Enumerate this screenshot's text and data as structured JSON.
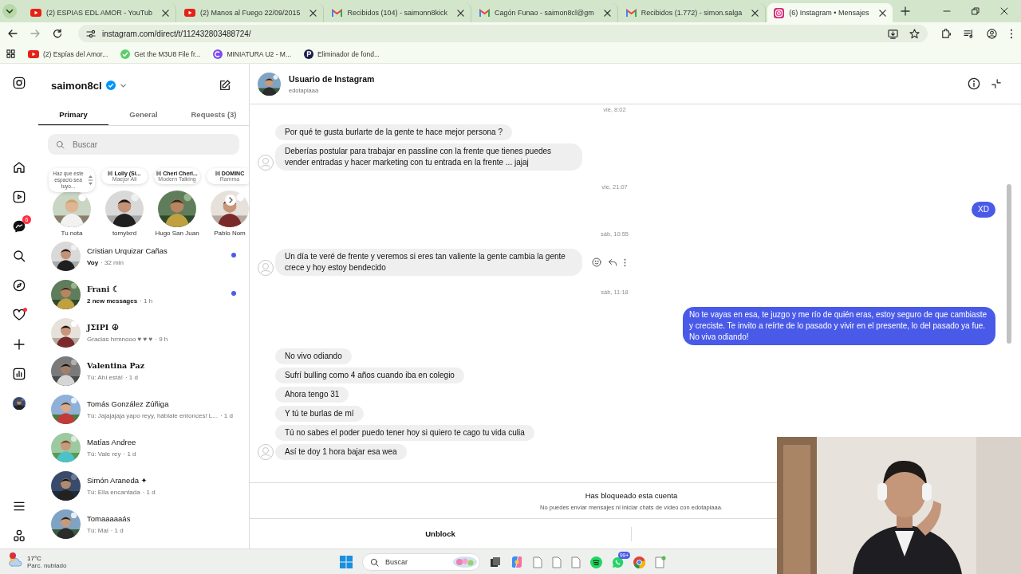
{
  "browser": {
    "tabs": [
      {
        "title": "(2) ESPIAS EDL AMOR - YouTub",
        "kind": "youtube",
        "selected": false
      },
      {
        "title": "(2) Manos al Fuego 22/09/2015",
        "kind": "youtube",
        "selected": false
      },
      {
        "title": "Recibidos (104) - saimonn8kick",
        "kind": "gmail",
        "selected": false
      },
      {
        "title": "Cagón Funao - saimon8cl@gm",
        "kind": "gmail",
        "selected": false
      },
      {
        "title": "Recibidos (1.772) - simon.salga",
        "kind": "gmail",
        "selected": false
      },
      {
        "title": "(6) Instagram • Mensajes",
        "kind": "instagram",
        "selected": true
      }
    ],
    "url": "instagram.com/direct/t/112432803488724/",
    "bookmarks": [
      {
        "label": "(2) Espías del Amor...",
        "kind": "youtube"
      },
      {
        "label": "Get the M3U8 File fr...",
        "kind": "check"
      },
      {
        "label": "MINIATURA U2 - M...",
        "kind": "canva"
      },
      {
        "label": "Eliminador de fond...",
        "kind": "remover"
      }
    ]
  },
  "nav": {
    "messages_badge": "6",
    "activity_dot": true
  },
  "inbox": {
    "username": "saimon8cl",
    "verified": true,
    "tabs": [
      {
        "label": "Primary",
        "selected": true
      },
      {
        "label": "General",
        "selected": false
      },
      {
        "label": "Requests (3)",
        "selected": false
      }
    ],
    "search": {
      "placeholder": "Buscar"
    },
    "notes": [
      {
        "kind": "text",
        "lines": [
          "Haz que este espacio sea tuyo..."
        ],
        "name": "Tu nota"
      },
      {
        "kind": "music",
        "lines": [
          "Lolly (Si...",
          "Maejor Ali"
        ],
        "name": "tomylxrd"
      },
      {
        "kind": "music",
        "lines": [
          "Cheri Cheri...",
          "Modern Talking"
        ],
        "name": "Hugo San Juan"
      },
      {
        "kind": "music",
        "lines": [
          "DOMINC",
          "Ramma"
        ],
        "name": "Pablo Nom"
      }
    ],
    "conversations": [
      {
        "name": "Cristian Urquizar Cañas",
        "fancy": false,
        "preview": "Voy",
        "time": "· 32 min",
        "unread": true
      },
      {
        "name": "Frani ☾",
        "fancy": true,
        "preview": "2 new messages",
        "time": "· 1 h",
        "unread": true
      },
      {
        "name": "JΣIPI ☮",
        "fancy": true,
        "preview": "Gracias hrmnooo ♥ ♥ ♥",
        "time": "· 9 h",
        "unread": false
      },
      {
        "name": "Valentina Paz",
        "fancy": true,
        "preview": "Tú: Ahí está!",
        "time": "· 1 d",
        "unread": false
      },
      {
        "name": "Tomás González Zúñiga",
        "fancy": false,
        "preview": "Tú: Jajajajaja yapo reyy, háblale entonces! L...",
        "time": "· 1 d",
        "unread": false
      },
      {
        "name": "Matías Andree",
        "fancy": false,
        "preview": "Tú: Vale rey",
        "time": "· 1 d",
        "unread": false
      },
      {
        "name": "Simón Araneda ✦",
        "fancy": false,
        "preview": "Tú: Ella encantada",
        "time": "· 1 d",
        "unread": false
      },
      {
        "name": "Tomaaaaaás",
        "fancy": false,
        "preview": "Tú: Mal",
        "time": "· 1 d",
        "unread": false
      }
    ]
  },
  "chat": {
    "title": "Usuario de Instagram",
    "subtitle": "edotapiaaa",
    "messages": [
      {
        "kind": "time",
        "text": "vie, 8:02"
      },
      {
        "kind": "in",
        "text": "Por qué te gusta burlarte de la gente te hace mejor persona ?",
        "avatar": false,
        "show_actions": false
      },
      {
        "kind": "in",
        "text": "Deberías postular para trabajar en passline con la frente que tienes puedes vender entradas y hacer marketing con tu entrada en la frente ... jajaj",
        "avatar": true,
        "show_actions": false
      },
      {
        "kind": "time",
        "text": "vie, 21:07"
      },
      {
        "kind": "out",
        "text": "XD"
      },
      {
        "kind": "time",
        "text": "sáb, 10:55"
      },
      {
        "kind": "in",
        "text": "Un día te veré de frente y veremos si eres tan valiente la gente cambia la gente crece y hoy estoy bendecido",
        "avatar": true,
        "show_actions": true
      },
      {
        "kind": "time",
        "text": "sáb, 11:18"
      },
      {
        "kind": "out",
        "text": "No te vayas en esa, te juzgo y me río de quién eras, estoy seguro de que cambiaste y creciste. Te invito a reírte de lo pasado y vivir en el presente, lo del pasado ya fue. No viva odiando!"
      },
      {
        "kind": "in",
        "text": "No vivo odiando",
        "avatar": false,
        "show_actions": false
      },
      {
        "kind": "in",
        "text": "Sufrí bulling como 4 años cuando iba en colegio",
        "avatar": false,
        "show_actions": false
      },
      {
        "kind": "in",
        "text": "Ahora tengo 31",
        "avatar": false,
        "show_actions": false
      },
      {
        "kind": "in",
        "text": "Y tú te burlas de mí",
        "avatar": false,
        "show_actions": false
      },
      {
        "kind": "in",
        "text": "Tú no sabes el poder puedo tener hoy si quiero te cago tu vida culia",
        "avatar": false,
        "show_actions": false
      },
      {
        "kind": "in",
        "text": "Así te doy 1 hora bajar esa wea",
        "avatar": true,
        "show_actions": false
      }
    ],
    "blocked": {
      "title": "Has bloqueado esta cuenta",
      "text": "No puedes enviar mensajes ni iniciar chats de vídeo con edotapiaaa.",
      "action": "Unblock"
    }
  },
  "taskbar": {
    "weather": {
      "temp": "17°C",
      "desc": "Parc. nublado",
      "alert": true
    },
    "search": {
      "placeholder": "Buscar"
    },
    "whatsapp_badge": "99+"
  }
}
